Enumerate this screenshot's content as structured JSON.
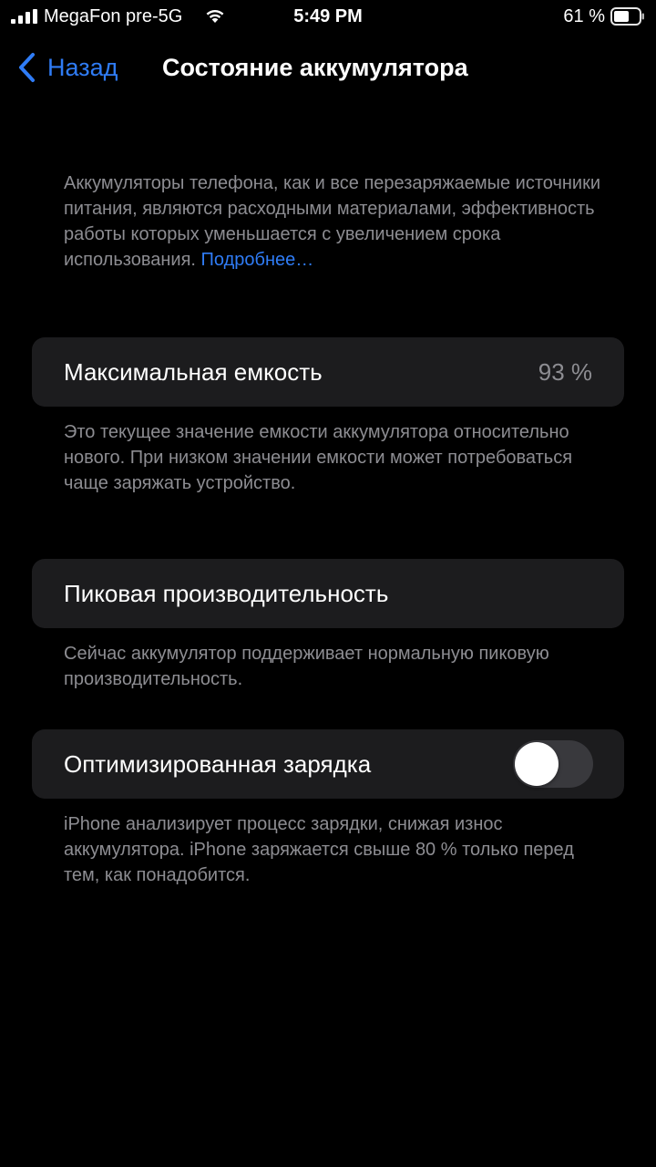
{
  "status_bar": {
    "carrier": "MegaFon pre-5G",
    "time": "5:49 PM",
    "battery_percent": "61 %",
    "icons": [
      "signal-icon",
      "wifi-icon",
      "battery-icon"
    ]
  },
  "nav": {
    "back_label": "Назад",
    "title": "Состояние аккумулятора",
    "back_icon": "chevron-left-icon"
  },
  "intro": {
    "text": "Аккумуляторы телефона, как и все перезаряжаемые источники питания, являются расходными материалами, эффективность работы которых уменьшается с увеличением срока использования.",
    "link": "Подробнее…"
  },
  "max_capacity": {
    "label": "Максимальная емкость",
    "value": "93 %",
    "footer": "Это текущее значение емкости аккумулятора относительно нового. При низком значении емкости может потребоваться чаще заряжать устройство."
  },
  "peak_performance": {
    "label": "Пиковая производительность",
    "footer": "Сейчас аккумулятор поддерживает нормальную пиковую производительность."
  },
  "optimized_charging": {
    "label": "Оптимизированная зарядка",
    "enabled": false,
    "footer": "iPhone анализирует процесс зарядки, снижая износ аккумулятора. iPhone заряжается свыше 80 % только перед тем, как понадобится."
  },
  "colors": {
    "background": "#000000",
    "cell": "#1c1c1e",
    "accent": "#2f7cf6",
    "secondary_text": "#8d8d92",
    "toggle_off": "#39393d"
  }
}
